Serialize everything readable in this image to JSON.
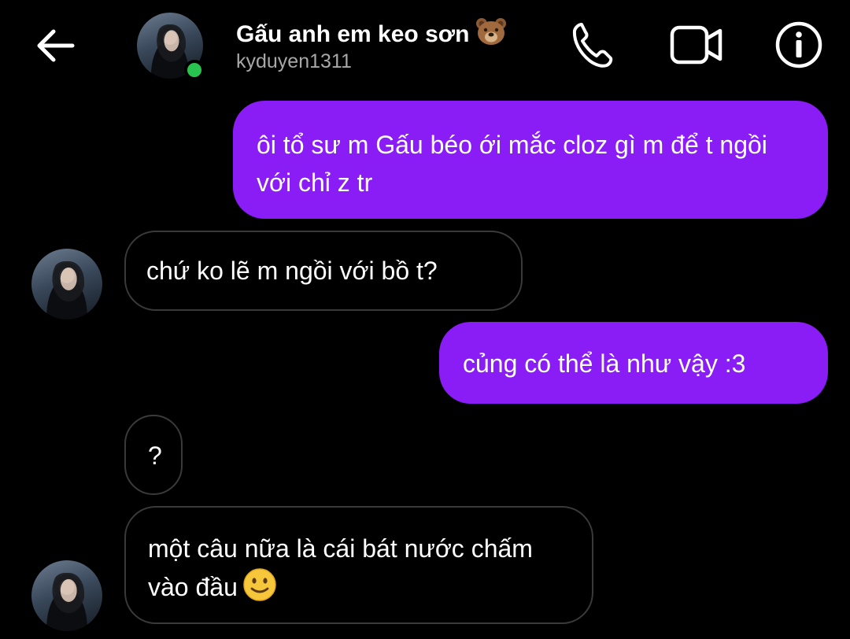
{
  "header": {
    "contact_name": "Gấu anh em keo sơn",
    "contact_emoji": "bear-face-icon",
    "username": "kyduyen1311",
    "online_status_color": "#29c34f",
    "icons": [
      "back-arrow-icon",
      "phone-icon",
      "video-camera-icon",
      "info-icon"
    ]
  },
  "messages": [
    {
      "direction": "outgoing",
      "text": "ôi tổ sư m Gấu béo ới mắc cloz gì m để t ngồi với chỉ z tr"
    },
    {
      "direction": "incoming",
      "text": "chứ ko lẽ m ngồi với bồ t?"
    },
    {
      "direction": "outgoing",
      "text": "củng có thể là như vậy :3"
    },
    {
      "direction": "incoming",
      "text": "?"
    },
    {
      "direction": "incoming",
      "text": "một câu nữa là cái bát nước chấm vào đầu",
      "emoji": "slightly-smiling-face-icon"
    }
  ],
  "colors": {
    "background": "#000000",
    "outgoing_bubble": "#8a1cf6",
    "incoming_border": "#3a3a3a",
    "secondary_text": "#a8a8a8"
  }
}
